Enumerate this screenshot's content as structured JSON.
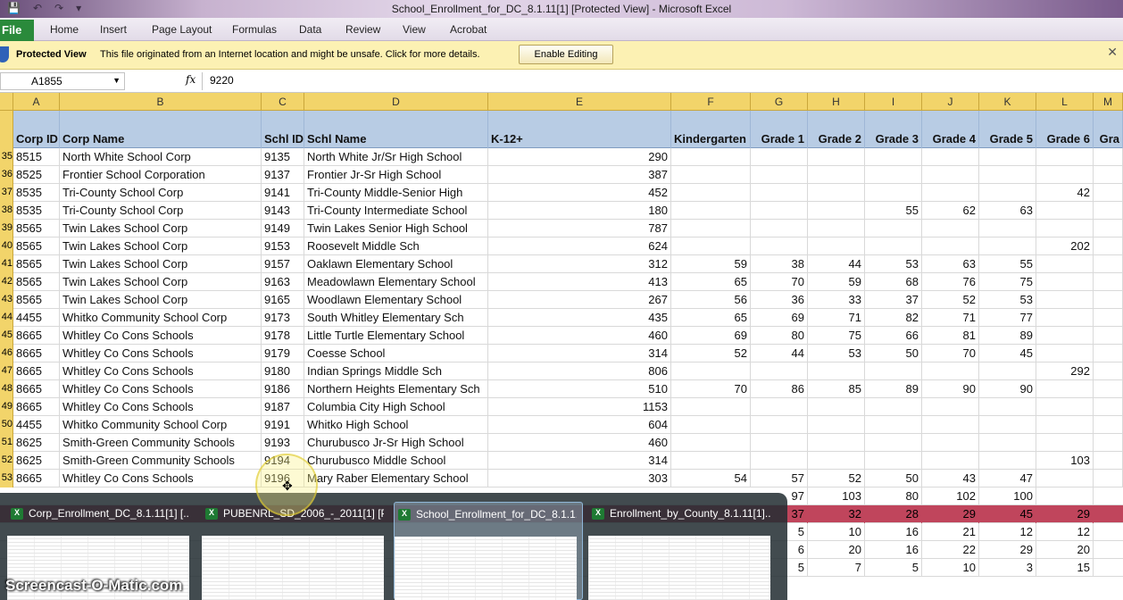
{
  "window": {
    "title": "School_Enrollment_for_DC_8.1.11[1]  [Protected View]  -  Microsoft Excel"
  },
  "ribbon": {
    "file_label": "File",
    "tabs": [
      "Home",
      "Insert",
      "Page Layout",
      "Formulas",
      "Data",
      "Review",
      "View",
      "Acrobat"
    ]
  },
  "protected_view": {
    "label": "Protected View",
    "message": "This file originated from an Internet location and might be unsafe. Click for more details.",
    "button": "Enable Editing"
  },
  "formula_bar": {
    "name_box": "A1855",
    "fx": "fx",
    "formula": "9220"
  },
  "columns": [
    "A",
    "B",
    "C",
    "D",
    "E",
    "F",
    "G",
    "H",
    "I",
    "J",
    "K",
    "L",
    "M"
  ],
  "header": {
    "corp_id": "Corp ID",
    "corp_name": "Corp Name",
    "schl_id": "Schl ID",
    "schl_name": "Schl Name",
    "k12": "K-12+",
    "kindergarten": "Kindergarten",
    "g1": "Grade 1",
    "g2": "Grade 2",
    "g3": "Grade 3",
    "g4": "Grade 4",
    "g5": "Grade 5",
    "g6": "Grade 6",
    "g7": "Gra"
  },
  "rows": [
    {
      "rn": "35",
      "a": "8515",
      "b": "North White School Corp",
      "c": "9135",
      "d": "North White Jr/Sr High School",
      "e": "290",
      "f": "",
      "g": "",
      "h": "",
      "i": "",
      "j": "",
      "k": "",
      "l": ""
    },
    {
      "rn": "36",
      "a": "8525",
      "b": "Frontier School Corporation",
      "c": "9137",
      "d": "Frontier Jr-Sr High School",
      "e": "387",
      "f": "",
      "g": "",
      "h": "",
      "i": "",
      "j": "",
      "k": "",
      "l": ""
    },
    {
      "rn": "37",
      "a": "8535",
      "b": "Tri-County School Corp",
      "c": "9141",
      "d": "Tri-County Middle-Senior High",
      "e": "452",
      "f": "",
      "g": "",
      "h": "",
      "i": "",
      "j": "",
      "k": "",
      "l": "42"
    },
    {
      "rn": "38",
      "a": "8535",
      "b": "Tri-County School Corp",
      "c": "9143",
      "d": "Tri-County Intermediate School",
      "e": "180",
      "f": "",
      "g": "",
      "h": "",
      "i": "55",
      "j": "62",
      "k": "63",
      "l": ""
    },
    {
      "rn": "39",
      "a": "8565",
      "b": "Twin Lakes School Corp",
      "c": "9149",
      "d": "Twin Lakes Senior High School",
      "e": "787",
      "f": "",
      "g": "",
      "h": "",
      "i": "",
      "j": "",
      "k": "",
      "l": ""
    },
    {
      "rn": "40",
      "a": "8565",
      "b": "Twin Lakes School Corp",
      "c": "9153",
      "d": "Roosevelt Middle Sch",
      "e": "624",
      "f": "",
      "g": "",
      "h": "",
      "i": "",
      "j": "",
      "k": "",
      "l": "202"
    },
    {
      "rn": "41",
      "a": "8565",
      "b": "Twin Lakes School Corp",
      "c": "9157",
      "d": "Oaklawn Elementary School",
      "e": "312",
      "f": "59",
      "g": "38",
      "h": "44",
      "i": "53",
      "j": "63",
      "k": "55",
      "l": ""
    },
    {
      "rn": "42",
      "a": "8565",
      "b": "Twin Lakes School Corp",
      "c": "9163",
      "d": "Meadowlawn Elementary School",
      "e": "413",
      "f": "65",
      "g": "70",
      "h": "59",
      "i": "68",
      "j": "76",
      "k": "75",
      "l": ""
    },
    {
      "rn": "43",
      "a": "8565",
      "b": "Twin Lakes School Corp",
      "c": "9165",
      "d": "Woodlawn Elementary School",
      "e": "267",
      "f": "56",
      "g": "36",
      "h": "33",
      "i": "37",
      "j": "52",
      "k": "53",
      "l": ""
    },
    {
      "rn": "44",
      "a": "4455",
      "b": "Whitko Community School Corp",
      "c": "9173",
      "d": "South Whitley Elementary Sch",
      "e": "435",
      "f": "65",
      "g": "69",
      "h": "71",
      "i": "82",
      "j": "71",
      "k": "77",
      "l": ""
    },
    {
      "rn": "45",
      "a": "8665",
      "b": "Whitley Co Cons Schools",
      "c": "9178",
      "d": "Little Turtle Elementary School",
      "e": "460",
      "f": "69",
      "g": "80",
      "h": "75",
      "i": "66",
      "j": "81",
      "k": "89",
      "l": ""
    },
    {
      "rn": "46",
      "a": "8665",
      "b": "Whitley Co Cons Schools",
      "c": "9179",
      "d": "Coesse School",
      "e": "314",
      "f": "52",
      "g": "44",
      "h": "53",
      "i": "50",
      "j": "70",
      "k": "45",
      "l": ""
    },
    {
      "rn": "47",
      "a": "8665",
      "b": "Whitley Co Cons Schools",
      "c": "9180",
      "d": "Indian Springs Middle Sch",
      "e": "806",
      "f": "",
      "g": "",
      "h": "",
      "i": "",
      "j": "",
      "k": "",
      "l": "292"
    },
    {
      "rn": "48",
      "a": "8665",
      "b": "Whitley Co Cons Schools",
      "c": "9186",
      "d": "Northern Heights Elementary Sch",
      "e": "510",
      "f": "70",
      "g": "86",
      "h": "85",
      "i": "89",
      "j": "90",
      "k": "90",
      "l": ""
    },
    {
      "rn": "49",
      "a": "8665",
      "b": "Whitley Co Cons Schools",
      "c": "9187",
      "d": "Columbia City High School",
      "e": "1153",
      "f": "",
      "g": "",
      "h": "",
      "i": "",
      "j": "",
      "k": "",
      "l": ""
    },
    {
      "rn": "50",
      "a": "4455",
      "b": "Whitko Community School Corp",
      "c": "9191",
      "d": "Whitko High School",
      "e": "604",
      "f": "",
      "g": "",
      "h": "",
      "i": "",
      "j": "",
      "k": "",
      "l": ""
    },
    {
      "rn": "51",
      "a": "8625",
      "b": "Smith-Green Community Schools",
      "c": "9193",
      "d": "Churubusco Jr-Sr High School",
      "e": "460",
      "f": "",
      "g": "",
      "h": "",
      "i": "",
      "j": "",
      "k": "",
      "l": ""
    },
    {
      "rn": "52",
      "a": "8625",
      "b": "Smith-Green Community Schools",
      "c": "9194",
      "d": "Churubusco Middle School",
      "e": "314",
      "f": "",
      "g": "",
      "h": "",
      "i": "",
      "j": "",
      "k": "",
      "l": "103"
    },
    {
      "rn": "53",
      "a": "8665",
      "b": "Whitley Co Cons Schools",
      "c": "9196",
      "d": "Mary Raber Elementary School",
      "e": "303",
      "f": "54",
      "g": "57",
      "h": "52",
      "i": "50",
      "j": "43",
      "k": "47",
      "l": ""
    }
  ],
  "partial_rows": [
    {
      "g": "97",
      "h": "103",
      "i": "80",
      "j": "102",
      "k": "100",
      "l": ""
    },
    {
      "g": "37",
      "h": "32",
      "i": "28",
      "j": "29",
      "k": "45",
      "l": "29"
    },
    {
      "g": "5",
      "h": "10",
      "i": "16",
      "j": "21",
      "k": "12",
      "l": "12"
    },
    {
      "g": "6",
      "h": "20",
      "i": "16",
      "j": "22",
      "k": "29",
      "l": "20"
    },
    {
      "g": "5",
      "h": "7",
      "i": "5",
      "j": "10",
      "k": "3",
      "l": "15"
    }
  ],
  "taskbar_thumbnails": [
    {
      "label": "Corp_Enrollment_DC_8.1.11[1] [..."
    },
    {
      "label": "PUBENRL_SD_2006_-_2011[1] [P..."
    },
    {
      "label": "School_Enrollment_for_DC_8.1.1..."
    },
    {
      "label": "Enrollment_by_County_8.1.11[1]..."
    }
  ],
  "watermark": "Screencast-O-Matic.com"
}
